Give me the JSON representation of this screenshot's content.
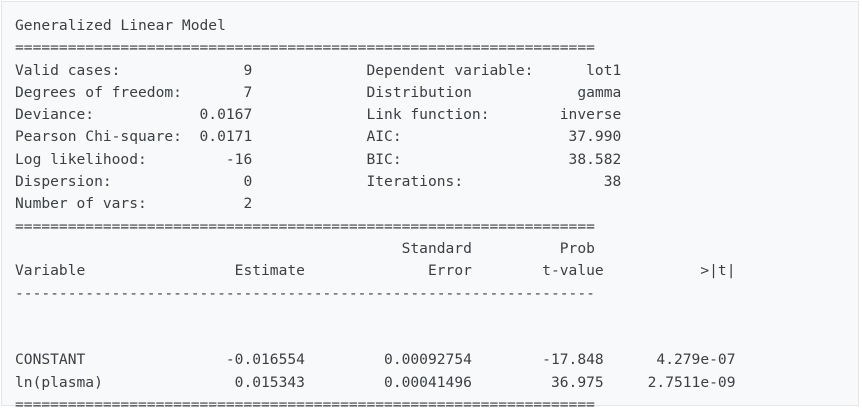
{
  "title": "Generalized Linear Model",
  "rule_double": "==================================================================",
  "rule_single": "------------------------------------------------------------------",
  "summary": {
    "left": [
      {
        "label": "Valid cases:",
        "value": "9"
      },
      {
        "label": "Degrees of freedom:",
        "value": "7"
      },
      {
        "label": "Deviance:",
        "value": "0.0167"
      },
      {
        "label": "Pearson Chi-square:",
        "value": "0.0171"
      },
      {
        "label": "Log likelihood:",
        "value": "-16"
      },
      {
        "label": "Dispersion:",
        "value": "0"
      },
      {
        "label": "Number of vars:",
        "value": "2"
      }
    ],
    "right": [
      {
        "label": "Dependent variable:",
        "value": "lot1"
      },
      {
        "label": "Distribution",
        "value": "gamma"
      },
      {
        "label": "Link function:",
        "value": "inverse"
      },
      {
        "label": "AIC:",
        "value": "37.990"
      },
      {
        "label": "BIC:",
        "value": "38.582"
      },
      {
        "label": "Iterations:",
        "value": "38"
      }
    ]
  },
  "table": {
    "header_row1": {
      "error": "Standard",
      "prob": "Prob"
    },
    "header_row2": {
      "variable": "Variable",
      "estimate": "Estimate",
      "error": "Error",
      "tvalue": "t-value",
      "prob": ">|t|"
    },
    "rows": [
      {
        "variable": "CONSTANT",
        "estimate": "-0.016554",
        "error": "0.00092754",
        "tvalue": "-17.848",
        "prob": "4.279e-07"
      },
      {
        "variable": "ln(plasma)",
        "estimate": "0.015343",
        "error": "0.00041496",
        "tvalue": "36.975",
        "prob": "2.7511e-09"
      }
    ]
  }
}
